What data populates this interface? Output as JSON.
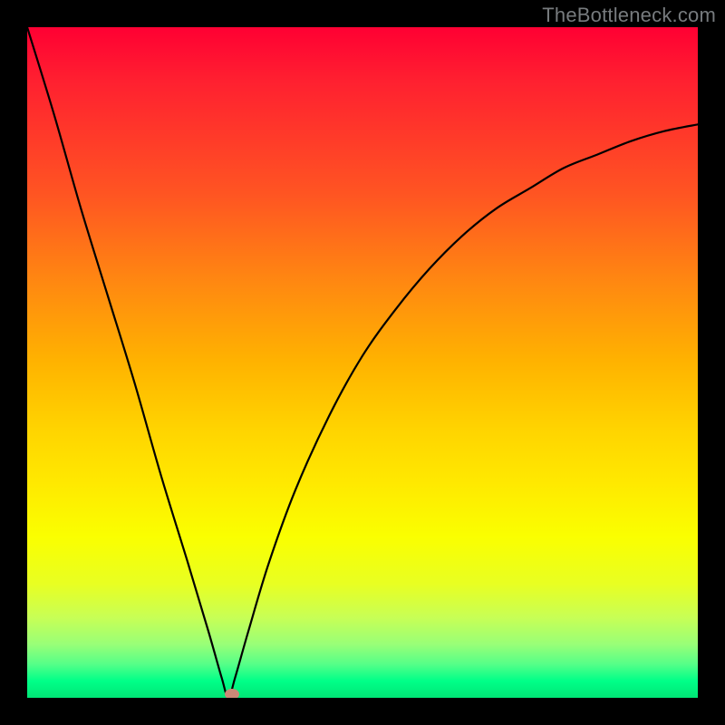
{
  "watermark": "TheBottleneck.com",
  "colors": {
    "frame": "#000000",
    "curve_stroke": "#000000",
    "marker_fill": "#cc8877"
  },
  "chart_data": {
    "type": "line",
    "title": "",
    "xlabel": "",
    "ylabel": "",
    "xlim": [
      0,
      100
    ],
    "ylim": [
      0,
      100
    ],
    "grid": false,
    "legend": false,
    "x": [
      0,
      4,
      8,
      12,
      16,
      20,
      24,
      27,
      29,
      30,
      31,
      33,
      36,
      40,
      45,
      50,
      55,
      60,
      65,
      70,
      75,
      80,
      85,
      90,
      95,
      100
    ],
    "values": [
      100,
      87,
      73,
      60,
      47,
      33,
      20,
      10,
      3,
      0,
      3,
      10,
      20,
      31,
      42,
      51,
      58,
      64,
      69,
      73,
      76,
      79,
      81,
      83,
      84.5,
      85.5
    ],
    "annotations": [
      {
        "type": "marker",
        "x": 30.5,
        "y": 0.5,
        "shape": "oval"
      }
    ],
    "notes": "V-shaped bottleneck curve; minimum near x≈30; values are percentage-like (read from relative vertical position, no axes/ticks shown)."
  }
}
